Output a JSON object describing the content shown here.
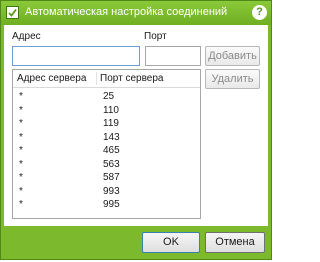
{
  "window": {
    "title": "Автоматическая настройка соединений",
    "help_label": "?"
  },
  "form": {
    "address_label": "Адрес",
    "port_label": "Порт",
    "address_value": "",
    "port_value": "",
    "add_button": "Добавить",
    "remove_button": "Удалить"
  },
  "list": {
    "columns": [
      "Адрес сервера",
      "Порт сервера"
    ],
    "rows": [
      {
        "server": "*",
        "port": "25"
      },
      {
        "server": "*",
        "port": "110"
      },
      {
        "server": "*",
        "port": "119"
      },
      {
        "server": "*",
        "port": "143"
      },
      {
        "server": "*",
        "port": "465"
      },
      {
        "server": "*",
        "port": "563"
      },
      {
        "server": "*",
        "port": "587"
      },
      {
        "server": "*",
        "port": "993"
      },
      {
        "server": "*",
        "port": "995"
      }
    ]
  },
  "footer": {
    "ok_button": "OK",
    "cancel_button": "Отмена"
  },
  "colors": {
    "frame": "#7cb92d",
    "help": "#5a9a16"
  }
}
